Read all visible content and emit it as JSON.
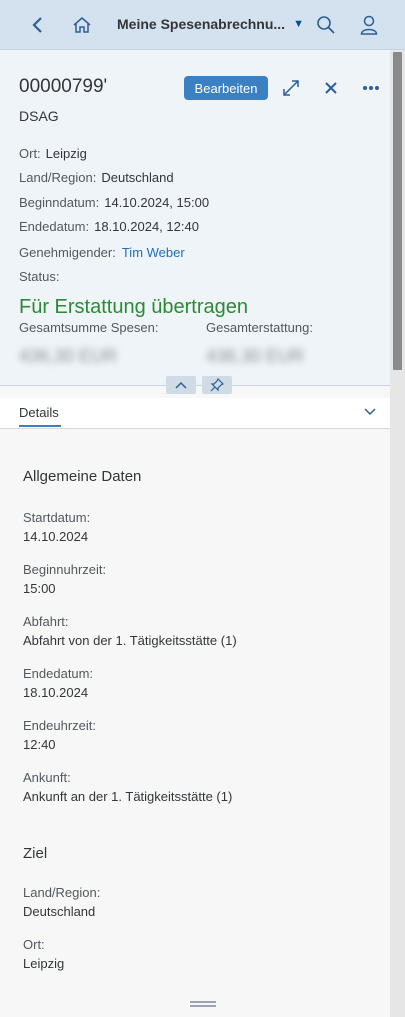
{
  "shell": {
    "title": "Meine Spesenabrechnu...",
    "back_icon": "chevron-left-icon",
    "home_icon": "home-icon",
    "search_icon": "search-icon",
    "user_icon": "user-icon"
  },
  "header": {
    "object_id": "00000799'",
    "subtitle": "DSAG",
    "edit_label": "Bearbeiten",
    "attributes": {
      "ort_label": "Ort:",
      "ort_value": "Leipzig",
      "land_label": "Land/Region:",
      "land_value": "Deutschland",
      "begin_label": "Beginndatum:",
      "begin_value": "14.10.2024, 15:00",
      "ende_label": "Endedatum:",
      "ende_value": "18.10.2024, 12:40",
      "approver_label": "Genehmigender:",
      "approver_value": "Tim Weber",
      "status_label": "Status:",
      "status_value": "Für Erstattung übertragen"
    },
    "kpis": {
      "total_label": "Gesamtsumme Spesen:",
      "total_value": "436,30 EUR",
      "refund_label": "Gesamterstattung:",
      "refund_value": "436,30 EUR"
    },
    "colors": {
      "accent": "#3b80c2",
      "status_green": "#2b8a33",
      "link": "#1a6fbf"
    }
  },
  "tabs": {
    "details_label": "Details"
  },
  "details": {
    "general_title": "Allgemeine Daten",
    "fields": [
      {
        "label": "Startdatum:",
        "value": "14.10.2024"
      },
      {
        "label": "Beginnuhrzeit:",
        "value": "15:00"
      },
      {
        "label": "Abfahrt:",
        "value": "Abfahrt von der 1. Tätigkeitsstätte (1)"
      },
      {
        "label": "Endedatum:",
        "value": "18.10.2024"
      },
      {
        "label": "Endeuhrzeit:",
        "value": "12:40"
      },
      {
        "label": "Ankunft:",
        "value": "Ankunft an der 1. Tätigkeitsstätte (1)"
      }
    ],
    "target_title": "Ziel",
    "target_fields": [
      {
        "label": "Land/Region:",
        "value": "Deutschland"
      },
      {
        "label": "Ort:",
        "value": "Leipzig"
      }
    ]
  }
}
